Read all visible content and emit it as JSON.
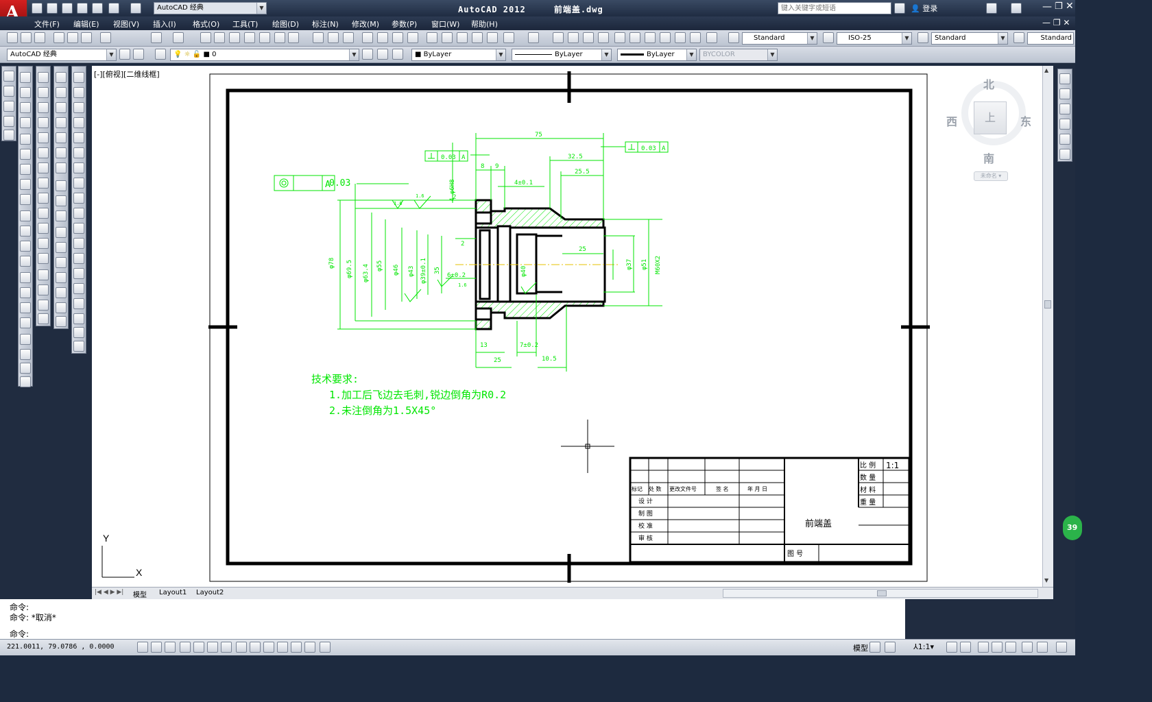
{
  "app": {
    "title": "AutoCAD  2012",
    "filename": "前端盖.dwg",
    "workspace_quick": "AutoCAD 经典",
    "logo": "A"
  },
  "search": {
    "placeholder": "键入关键字或短语",
    "login": "登录"
  },
  "menu": [
    "文件(F)",
    "编辑(E)",
    "视图(V)",
    "插入(I)",
    "格式(O)",
    "工具(T)",
    "绘图(D)",
    "标注(N)",
    "修改(M)",
    "参数(P)",
    "窗口(W)",
    "帮助(H)"
  ],
  "styles": {
    "text": "Standard",
    "dim": "ISO-25",
    "table": "Standard",
    "multileader": "Standard"
  },
  "layers": {
    "workspace": "AutoCAD 经典",
    "current_layer": "0",
    "color": "ByLayer",
    "linetype": "ByLayer",
    "lineweight": "ByLayer",
    "plotstyle": "BYCOLOR"
  },
  "viewport": {
    "label": "[-][俯视][二维线框]",
    "ucs_y": "Y",
    "ucs_x": "X"
  },
  "viewcube": {
    "north": "北",
    "south": "南",
    "east": "东",
    "west": "西",
    "face": "上",
    "wcs": "未命名"
  },
  "drawing": {
    "tech_req_title": "技术要求:",
    "tech_req_1": "1.加工后飞边去毛刺,锐边倒角为R0.2",
    "tech_req_2": "2.未注倒角为1.5X45°",
    "fcf_big": {
      "tol": "0.03",
      "datum": "A"
    },
    "fcf_small_left": {
      "tol": "0.03",
      "datum": "A"
    },
    "fcf_small_right": {
      "tol": "0.03",
      "datum": "A"
    },
    "dims_top": [
      "75",
      "32.5",
      "25.5",
      "8",
      "9",
      "4±0.1",
      "2",
      "25",
      "2",
      "1.6",
      "1.6",
      "1.6"
    ],
    "dims_bottom": [
      "13",
      "7±0.2",
      "25",
      "10.5"
    ],
    "dims_left": [
      "φ78",
      "φ69.5",
      "φ63.4",
      "φ55",
      "φ46",
      "φ43",
      "φ39±0.1",
      "35",
      "6±0.2",
      "4-φ6H8",
      "φ40"
    ],
    "dims_right": [
      "φ37",
      "φ51",
      "M60X2"
    ]
  },
  "title_block": {
    "part_name": "前端盖",
    "scale_label": "比 例",
    "scale_value": "1:1",
    "qty_label": "数 量",
    "material_label": "材 料",
    "weight_label": "重 量",
    "drawing_no_label": "图  号",
    "header": [
      "标记",
      "处 数",
      "更改文件号",
      "签 名",
      "年 月 日"
    ],
    "rows": [
      "设 计",
      "制 图",
      "校 准",
      "审 核"
    ]
  },
  "tabs": [
    "模型",
    "Layout1",
    "Layout2"
  ],
  "command": {
    "line1": "命令:",
    "line2": "命令: *取消*",
    "prompt": "命令:"
  },
  "status": {
    "coords": "221.0011, 79.0786 , 0.0000",
    "model": "模型",
    "anno_scale": "1:1"
  },
  "notification": "39"
}
